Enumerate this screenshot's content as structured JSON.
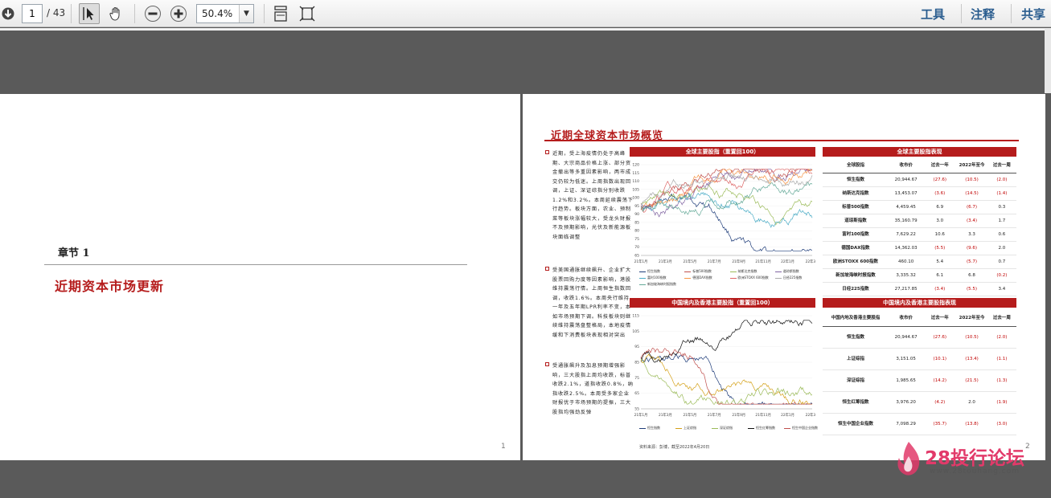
{
  "toolbar": {
    "page_current": "1",
    "page_total": "/ 43",
    "zoom": "50.4%",
    "links": [
      "工具",
      "注释",
      "共享"
    ]
  },
  "page1": {
    "chapter": "章节 1",
    "title": "近期资本市场更新",
    "page_number": "1"
  },
  "page2": {
    "title": "近期全球资本市场概览",
    "page_number": "2",
    "paragraphs": [
      "近期，受上海疫情仍处于高峰期、大宗商品价格上涨、部分资金撤出等多重因素影响，两市成交仍较为低迷。上周指数出现回调，上证、深证综指分别收跌1.2%和3.2%。本周延续震荡下行趋势。板块方面，农业、预制菜等板块涨幅较大，受龙头财报不及预期影响，光伏及新能源板块面临调整",
      "受美国通胀继续飙升、企业扩大股票回购力度等因素影响，港股维持震荡行情。上周恒生指数回调，收跌1.6%。本周央行维持一年及五年期LPR利率不变，本如市场预期下调。科技板块则继续维持震荡盘整格局，本地疫情缓和下消费板块表现相对突出",
      "受通胀飙升及加息预期增强影响，三大股指上周均收跌，标普收跌2.1%，道指收跌0.8%，纳指收跌2.5%。本周受多家企业财报优于市场预期的提振，三大股指均强劲反弹"
    ],
    "chart1": {
      "heading": "全球主要股指（重置回100）",
      "y_ticks": [
        "120",
        "115",
        "110",
        "105",
        "100",
        "95",
        "90",
        "85",
        "80",
        "75",
        "70",
        "65"
      ],
      "x_ticks": [
        "21年1月",
        "21年3月",
        "21年5月",
        "21年7月",
        "21年9月",
        "21年11月",
        "22年1月",
        "22年3月"
      ],
      "legend": [
        "恒生指数",
        "标普500指数",
        "纳斯达克指数",
        "道琼斯指数",
        "富时100指数",
        "德国DAX指数",
        "欧洲STOXX 600指数",
        "日经225指数",
        "新加坡海峡时报指数"
      ]
    },
    "table1": {
      "heading": "全球主要股指表现",
      "columns": [
        "全球股指",
        "收市价",
        "过去一年",
        "2022年至今",
        "过去一周"
      ],
      "rows": [
        [
          "恒生指数",
          "20,944.67",
          "(27.6)",
          "(10.5)",
          "(2.0)"
        ],
        [
          "纳斯达克指数",
          "13,453.07",
          "(3.6)",
          "(14.5)",
          "(1.4)"
        ],
        [
          "标普500指数",
          "4,459.45",
          "6.9",
          "(6.7)",
          "0.3"
        ],
        [
          "道琼斯指数",
          "35,160.79",
          "3.0",
          "(3.4)",
          "1.7"
        ],
        [
          "富时100指数",
          "7,629.22",
          "10.6",
          "3.3",
          "0.6"
        ],
        [
          "德国DAX指数",
          "14,362.03",
          "(5.5)",
          "(9.6)",
          "2.0"
        ],
        [
          "欧洲STOXX 600指数",
          "460.10",
          "5.4",
          "(5.7)",
          "0.7"
        ],
        [
          "新加坡海峡时报指数",
          "3,335.32",
          "6.1",
          "6.8",
          "(0.2)"
        ],
        [
          "日经225指数",
          "27,217.85",
          "(3.4)",
          "(5.5)",
          "3.4"
        ]
      ]
    },
    "chart2": {
      "heading": "中国境内及香港主要股指（重置回100）",
      "y_ticks": [
        "115",
        "105",
        "95",
        "85",
        "75",
        "65",
        "55"
      ],
      "x_ticks": [
        "21年1月",
        "21年3月",
        "21年5月",
        "21年7月",
        "21年9月",
        "21年11月",
        "22年1月",
        "22年3月"
      ],
      "legend": [
        "恒生指数",
        "上证综指",
        "深证综指",
        "恒生红筹指数",
        "恒生中国企业指数"
      ]
    },
    "table2": {
      "heading": "中国境内及香港主要股指表现",
      "columns": [
        "中国内地及香港主要股指",
        "收市价",
        "过去一年",
        "2022年至今",
        "过去一周"
      ],
      "rows": [
        [
          "恒生指数",
          "20,944.67",
          "(27.6)",
          "(10.5)",
          "(2.0)"
        ],
        [
          "上证综指",
          "3,151.05",
          "(10.1)",
          "(13.4)",
          "(1.1)"
        ],
        [
          "深证综指",
          "1,985.65",
          "(14.2)",
          "(21.5)",
          "(1.3)"
        ],
        [
          "恒生红筹指数",
          "3,976.20",
          "(4.2)",
          "2.0",
          "(1.9)"
        ],
        [
          "恒生中国企业指数",
          "7,098.29",
          "(35.7)",
          "(13.8)",
          "(3.0)"
        ]
      ]
    },
    "source": "资料来源：彭博，截至2022年4月20日"
  },
  "watermark": {
    "text": "28投行论坛",
    "url": "www.28touhang.com"
  },
  "colors": {
    "accent_red": "#b51c1c",
    "link_blue": "#2a5d8f"
  }
}
